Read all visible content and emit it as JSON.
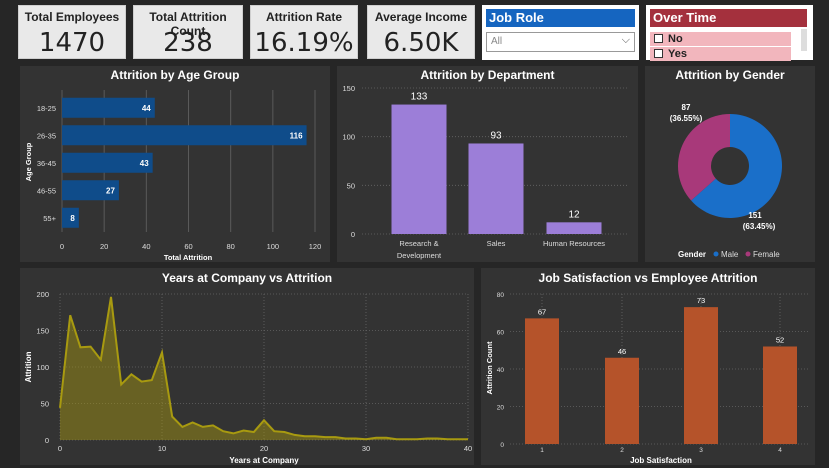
{
  "kpis": {
    "total_employees": {
      "label": "Total Employees",
      "value": "1470"
    },
    "attrition_count": {
      "label": "Total Attrition Count",
      "value": "238"
    },
    "attrition_rate": {
      "label": "Attrition Rate",
      "value": "16.19%"
    },
    "avg_income": {
      "label": "Average Income",
      "value": "6.50K"
    }
  },
  "job_role": {
    "title": "Job Role",
    "selected": "All",
    "header_color": "#1565c0"
  },
  "over_time": {
    "title": "Over Time",
    "options": [
      "No",
      "Yes"
    ],
    "header_color": "#a4303d"
  },
  "chart_data": [
    {
      "type": "bar",
      "orientation": "horizontal",
      "title": "Attrition by Age Group",
      "categories": [
        "18-25",
        "26-35",
        "36-45",
        "46-55",
        "55+"
      ],
      "values": [
        44,
        116,
        43,
        27,
        8
      ],
      "xlabel": "Total Attrition",
      "ylabel": "Age Group",
      "xlim": [
        0,
        120
      ],
      "xticks": [
        "0",
        "20",
        "40",
        "60",
        "80",
        "100",
        "120"
      ],
      "color": "#0f4c8a"
    },
    {
      "type": "bar",
      "title": "Attrition by Department",
      "categories": [
        "Research & Development",
        "Sales",
        "Human Resources"
      ],
      "category_lines": [
        [
          "Research &",
          "Development"
        ],
        [
          "Sales"
        ],
        [
          "Human Resources"
        ]
      ],
      "values": [
        133,
        93,
        12
      ],
      "ylim": [
        0,
        150
      ],
      "yticks": [
        "0",
        "50",
        "100",
        "150"
      ],
      "color": "#9c7ed8"
    },
    {
      "type": "pie",
      "title": "Attrition by Gender",
      "legend_title": "Gender",
      "slices": [
        {
          "name": "Male",
          "value": 151,
          "pct": "(63.45%)",
          "color": "#1a6fc9"
        },
        {
          "name": "Female",
          "value": 87,
          "pct": "(36.55%)",
          "color": "#a8397a"
        }
      ]
    },
    {
      "type": "area",
      "title": "Years at Company vs Attrition",
      "xlabel": "Years at Company",
      "ylabel": "Attrition",
      "x": [
        0,
        1,
        2,
        3,
        4,
        5,
        6,
        7,
        8,
        9,
        10,
        11,
        12,
        13,
        14,
        15,
        16,
        17,
        18,
        19,
        20,
        21,
        22,
        23,
        24,
        25,
        26,
        27,
        28,
        29,
        30,
        31,
        32,
        33,
        34,
        35,
        36,
        37,
        38,
        39,
        40
      ],
      "y": [
        44,
        171,
        127,
        128,
        110,
        196,
        76,
        90,
        80,
        82,
        120,
        32,
        18,
        24,
        18,
        20,
        12,
        9,
        13,
        11,
        27,
        12,
        11,
        7,
        5,
        5,
        4,
        4,
        2,
        2,
        1,
        3,
        3,
        1,
        1,
        1,
        2,
        2,
        1,
        1,
        1
      ],
      "xlim": [
        0,
        40
      ],
      "ylim": [
        0,
        200
      ],
      "xticks": [
        "0",
        "10",
        "20",
        "30",
        "40"
      ],
      "yticks": [
        "0",
        "50",
        "100",
        "150",
        "200"
      ],
      "color": "#a89a10"
    },
    {
      "type": "bar",
      "title": "Job Satisfaction vs Employee Attrition",
      "categories": [
        "1",
        "2",
        "3",
        "4"
      ],
      "values": [
        67,
        46,
        73,
        52
      ],
      "xlabel": "Job Satisfaction",
      "ylabel": "Attrition Count",
      "ylim": [
        0,
        80
      ],
      "yticks": [
        "0",
        "20",
        "40",
        "60",
        "80"
      ],
      "color": "#b5532a"
    }
  ]
}
